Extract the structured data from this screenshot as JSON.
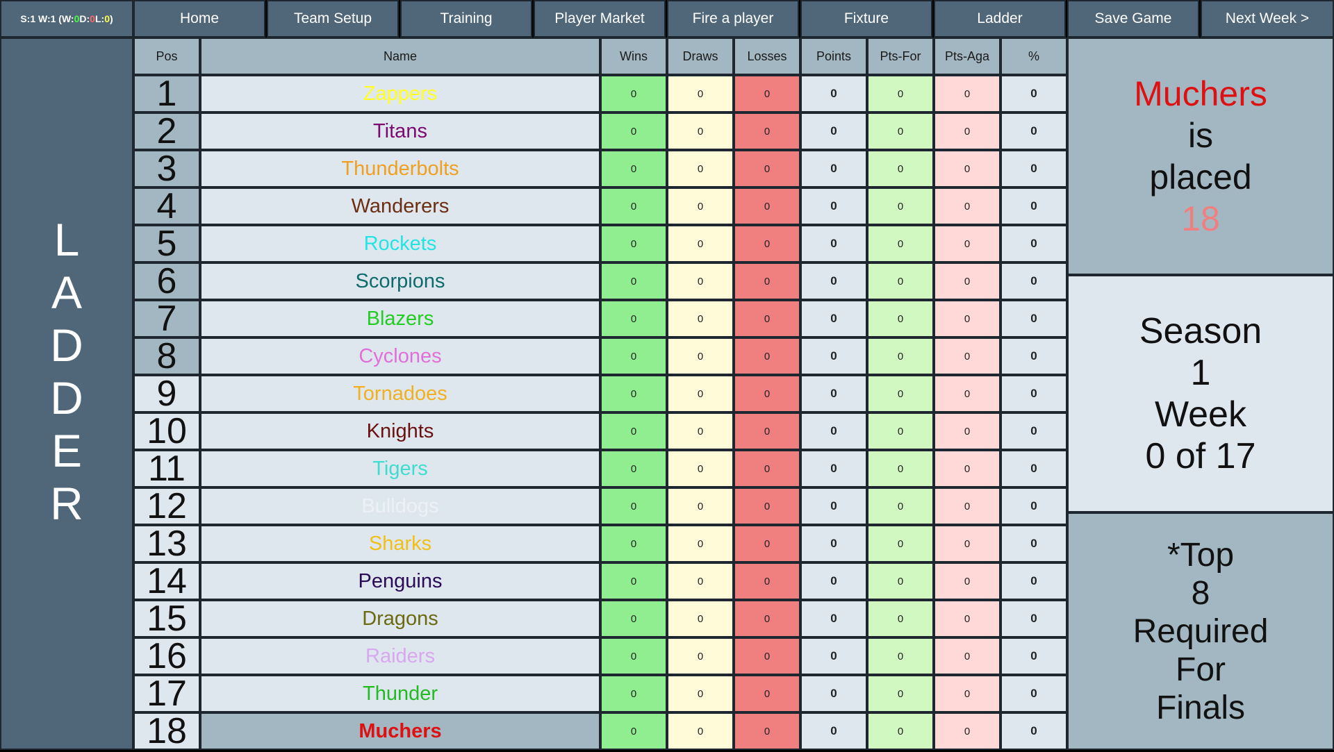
{
  "status": {
    "prefix": "S:1 W:1 (W:",
    "w": "0",
    "d_label": " D:",
    "d": "0",
    "l_label": " L:",
    "l": "0",
    "suffix": ")"
  },
  "nav": [
    "Home",
    "Team Setup",
    "Training",
    "Player Market",
    "Fire a player",
    "Fixture",
    "Ladder",
    "Save Game",
    "Next Week >"
  ],
  "side_title": [
    "L",
    "A",
    "D",
    "D",
    "E",
    "R"
  ],
  "headers": {
    "pos": "Pos",
    "name": "Name",
    "wins": "Wins",
    "draws": "Draws",
    "losses": "Losses",
    "points": "Points",
    "pts_for": "Pts-For",
    "pts_aga": "Pts-Aga",
    "pct": "%"
  },
  "rows": [
    {
      "pos": "1",
      "name": "Zappers",
      "color": "#ffff22",
      "wins": "0",
      "draws": "0",
      "losses": "0",
      "points": "0",
      "pts_for": "0",
      "pts_aga": "0",
      "pct": "0"
    },
    {
      "pos": "2",
      "name": "Titans",
      "color": "#7a0a6e",
      "wins": "0",
      "draws": "0",
      "losses": "0",
      "points": "0",
      "pts_for": "0",
      "pts_aga": "0",
      "pct": "0"
    },
    {
      "pos": "3",
      "name": "Thunderbolts",
      "color": "#f0a020",
      "wins": "0",
      "draws": "0",
      "losses": "0",
      "points": "0",
      "pts_for": "0",
      "pts_aga": "0",
      "pct": "0"
    },
    {
      "pos": "4",
      "name": "Wanderers",
      "color": "#6b2e12",
      "wins": "0",
      "draws": "0",
      "losses": "0",
      "points": "0",
      "pts_for": "0",
      "pts_aga": "0",
      "pct": "0"
    },
    {
      "pos": "5",
      "name": "Rockets",
      "color": "#22e4e4",
      "wins": "0",
      "draws": "0",
      "losses": "0",
      "points": "0",
      "pts_for": "0",
      "pts_aga": "0",
      "pct": "0"
    },
    {
      "pos": "6",
      "name": "Scorpions",
      "color": "#0e6b6b",
      "wins": "0",
      "draws": "0",
      "losses": "0",
      "points": "0",
      "pts_for": "0",
      "pts_aga": "0",
      "pct": "0"
    },
    {
      "pos": "7",
      "name": "Blazers",
      "color": "#22cc22",
      "wins": "0",
      "draws": "0",
      "losses": "0",
      "points": "0",
      "pts_for": "0",
      "pts_aga": "0",
      "pct": "0"
    },
    {
      "pos": "8",
      "name": "Cyclones",
      "color": "#e070d8",
      "wins": "0",
      "draws": "0",
      "losses": "0",
      "points": "0",
      "pts_for": "0",
      "pts_aga": "0",
      "pct": "0"
    },
    {
      "pos": "9",
      "name": "Tornadoes",
      "color": "#f0b020",
      "wins": "0",
      "draws": "0",
      "losses": "0",
      "points": "0",
      "pts_for": "0",
      "pts_aga": "0",
      "pct": "0"
    },
    {
      "pos": "10",
      "name": "Knights",
      "color": "#6b1010",
      "wins": "0",
      "draws": "0",
      "losses": "0",
      "points": "0",
      "pts_for": "0",
      "pts_aga": "0",
      "pct": "0"
    },
    {
      "pos": "11",
      "name": "Tigers",
      "color": "#40dcd0",
      "wins": "0",
      "draws": "0",
      "losses": "0",
      "points": "0",
      "pts_for": "0",
      "pts_aga": "0",
      "pct": "0"
    },
    {
      "pos": "12",
      "name": "Bulldogs",
      "color": "#eef0f8",
      "wins": "0",
      "draws": "0",
      "losses": "0",
      "points": "0",
      "pts_for": "0",
      "pts_aga": "0",
      "pct": "0"
    },
    {
      "pos": "13",
      "name": "Sharks",
      "color": "#f0c018",
      "wins": "0",
      "draws": "0",
      "losses": "0",
      "points": "0",
      "pts_for": "0",
      "pts_aga": "0",
      "pct": "0"
    },
    {
      "pos": "14",
      "name": "Penguins",
      "color": "#2a0a55",
      "wins": "0",
      "draws": "0",
      "losses": "0",
      "points": "0",
      "pts_for": "0",
      "pts_aga": "0",
      "pct": "0"
    },
    {
      "pos": "15",
      "name": "Dragons",
      "color": "#6b6a10",
      "wins": "0",
      "draws": "0",
      "losses": "0",
      "points": "0",
      "pts_for": "0",
      "pts_aga": "0",
      "pct": "0"
    },
    {
      "pos": "16",
      "name": "Raiders",
      "color": "#d8a8ee",
      "wins": "0",
      "draws": "0",
      "losses": "0",
      "points": "0",
      "pts_for": "0",
      "pts_aga": "0",
      "pct": "0"
    },
    {
      "pos": "17",
      "name": "Thunder",
      "color": "#22bb22",
      "wins": "0",
      "draws": "0",
      "losses": "0",
      "points": "0",
      "pts_for": "0",
      "pts_aga": "0",
      "pct": "0"
    },
    {
      "pos": "18",
      "name": "Muchers",
      "color": "#dd1111",
      "wins": "0",
      "draws": "0",
      "losses": "0",
      "points": "0",
      "pts_for": "0",
      "pts_aga": "0",
      "pct": "0",
      "highlight": true
    }
  ],
  "placed": {
    "team": "Muchers",
    "is": "is",
    "placed": "placed",
    "position": "18"
  },
  "season": {
    "season_label": "Season",
    "season": "1",
    "week_label": "Week",
    "week_text": "0 of 17"
  },
  "finals": {
    "line1": "*Top",
    "line2": "8",
    "line3": "Required",
    "line4": "For",
    "line5": "Finals"
  },
  "colors": {
    "panel_dark": "#4f6779",
    "panel_light": "#a3b7c3",
    "row_bg": "#dfe7ee",
    "wins_bg": "#90ee90",
    "draws_bg": "#fffad8",
    "losses_bg": "#f08080",
    "pts_for_bg": "#d0f8c0",
    "pts_aga_bg": "#ffd8d8",
    "status_green": "#44ff44",
    "status_red": "#ff6666",
    "status_yellow": "#ffff44",
    "placed_team": "#dd1111",
    "placed_pos": "#f08080"
  }
}
